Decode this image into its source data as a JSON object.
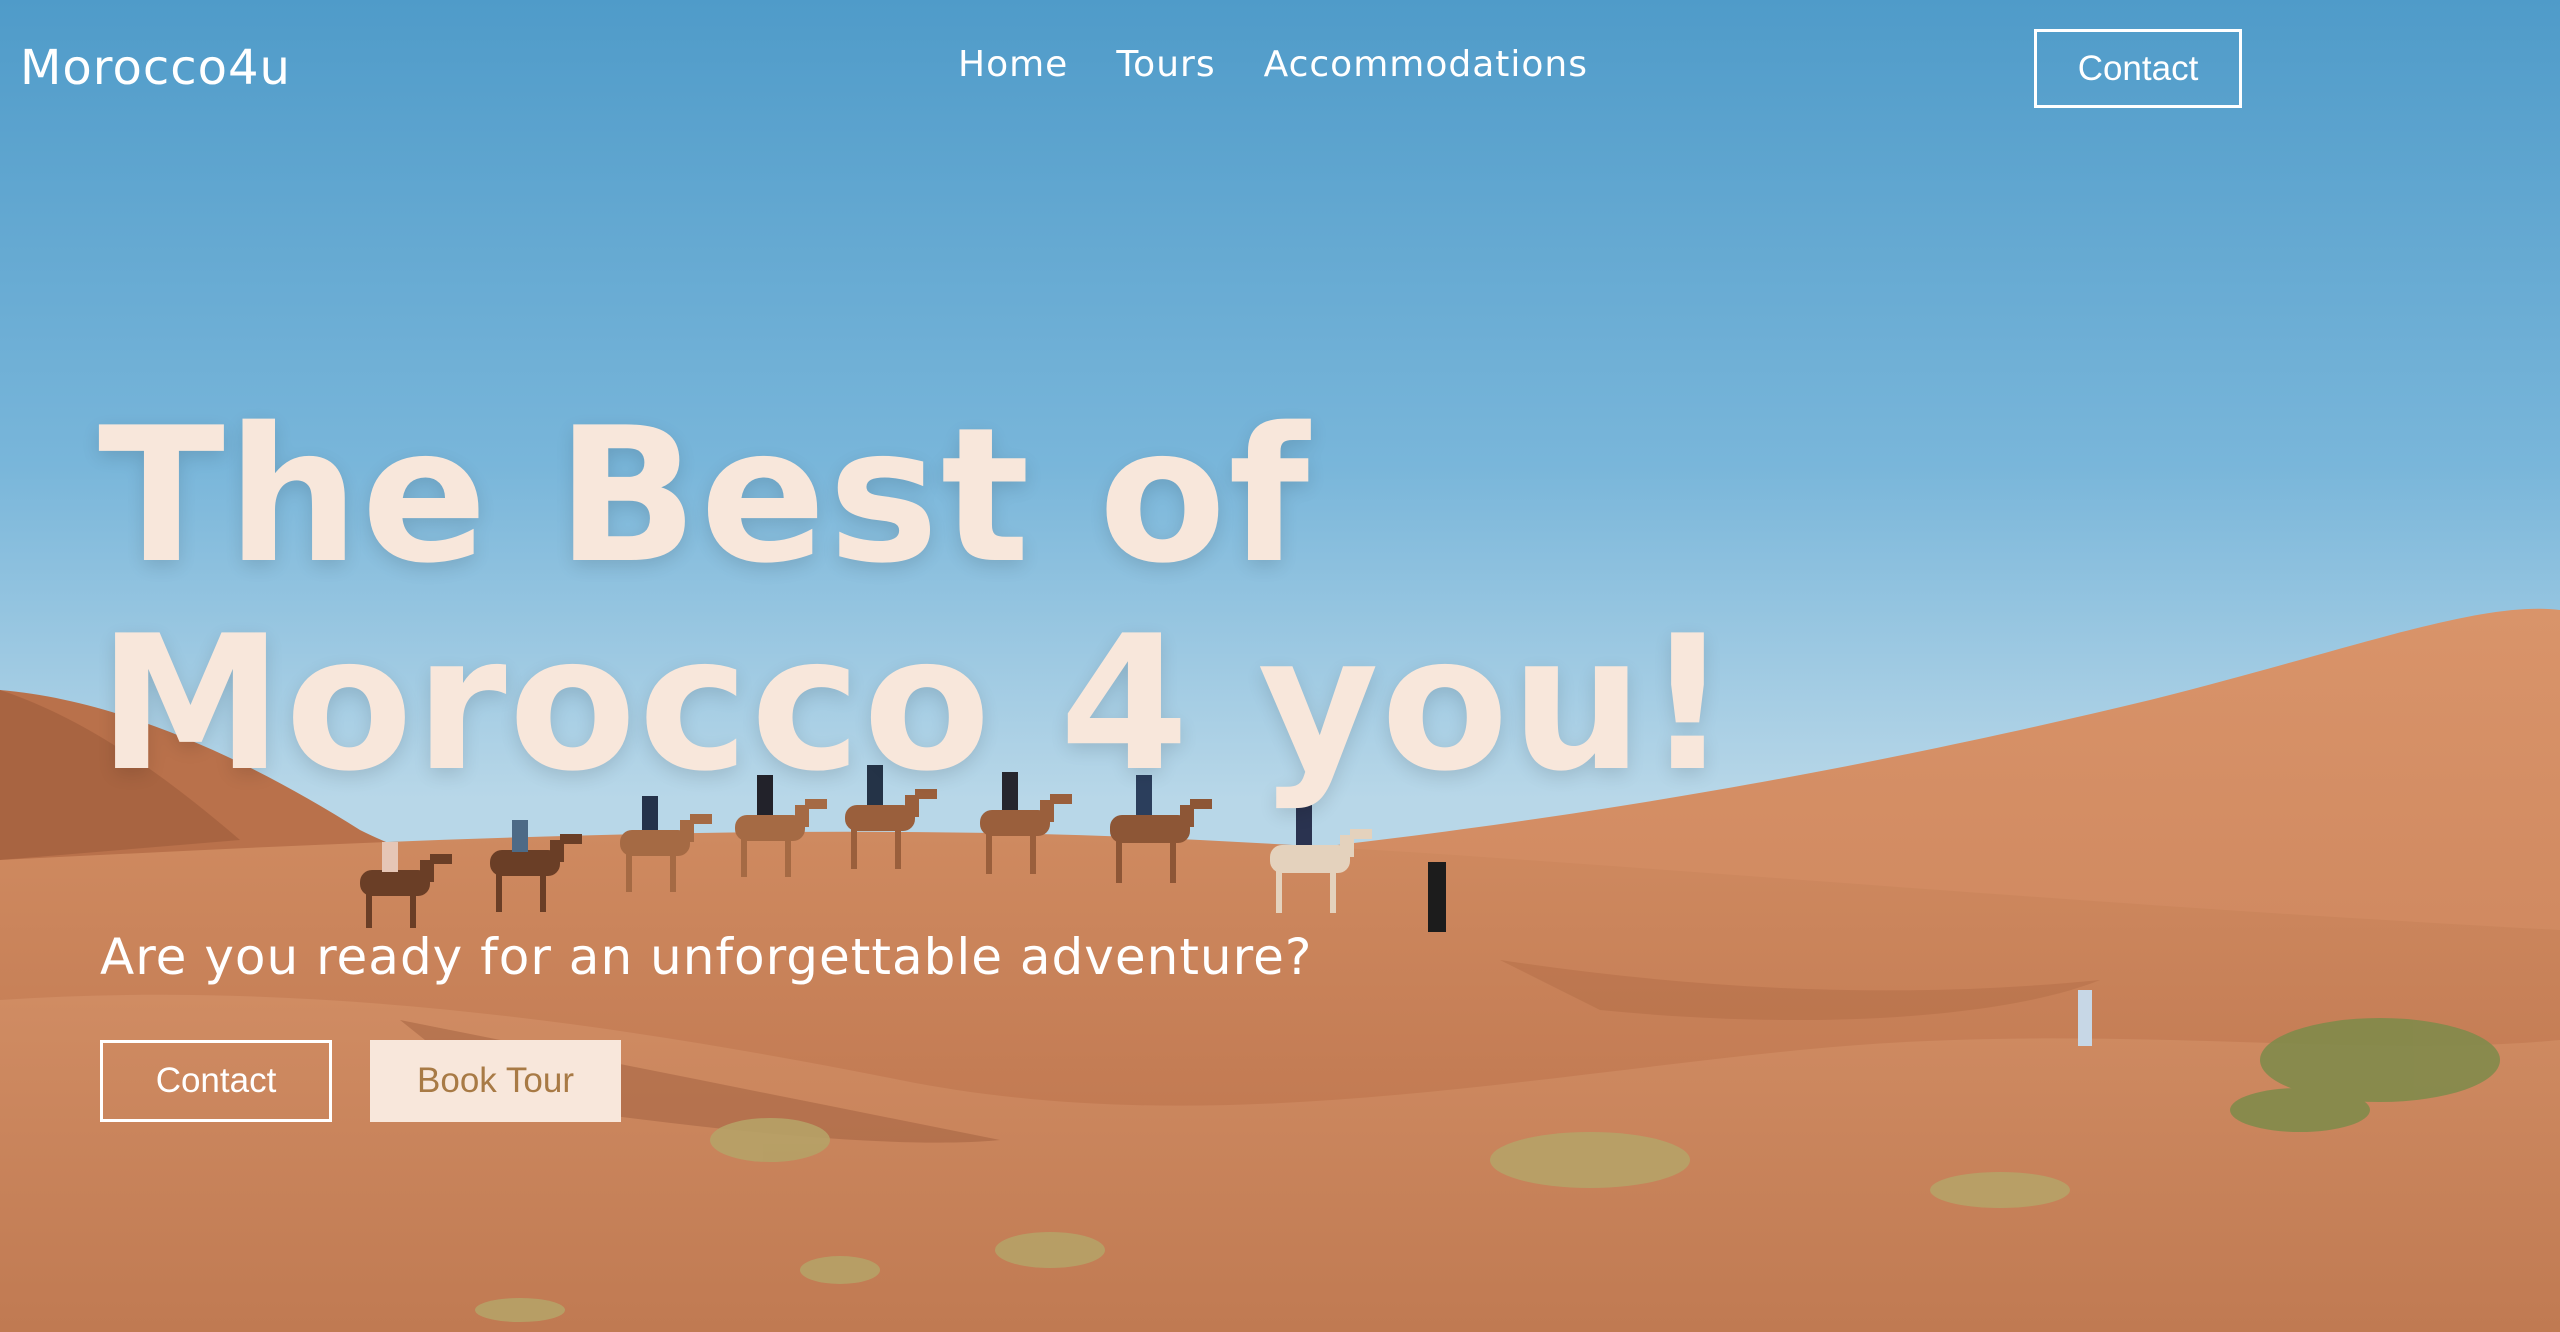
{
  "brand": "Morocco4u",
  "nav": {
    "items": [
      {
        "label": "Home"
      },
      {
        "label": "Tours"
      },
      {
        "label": "Accommodations"
      }
    ],
    "contact_label": "Contact"
  },
  "hero": {
    "headline_line1": "The Best of",
    "headline_line2": "Morocco 4 you!",
    "subheading": "Are you ready for an unforgettable adventure?",
    "contact_label": "Contact",
    "book_label": "Book Tour"
  },
  "colors": {
    "headline": "#f8e7db",
    "book_button_bg": "#f8e7db",
    "book_button_text": "#a87a45",
    "sky_top": "#4f9bc9",
    "sand": "#c8835a"
  },
  "background_image": "desert-camel-caravan"
}
